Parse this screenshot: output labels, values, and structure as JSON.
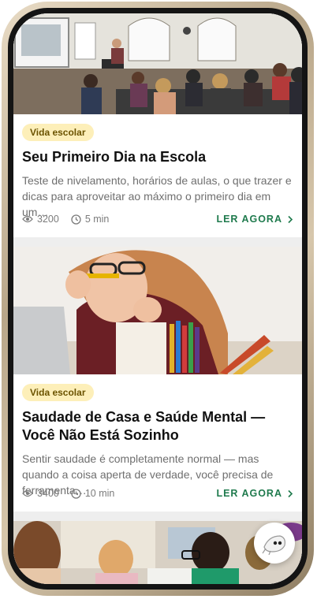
{
  "articles": [
    {
      "category": "Vida escolar",
      "title": "Seu Primeiro Dia na Escola",
      "excerpt": "Teste de nivelamento, horários de aulas, o que trazer e dicas para aproveitar ao máximo o primeiro dia em um…",
      "views": "3200",
      "read_time": "5 min",
      "cta": "LER AGORA"
    },
    {
      "category": "Vida escolar",
      "title": "Saudade de Casa e Saúde Mental — Você Não Está Sozinho",
      "excerpt": "Sentir saudade é completamente normal — mas quando a coisa aperta de verdade, você precisa de ferramenta…",
      "views": "3400",
      "read_time": "10 min",
      "cta": "LER AGORA"
    }
  ],
  "icons": {
    "views": "eye-icon",
    "time": "clock-icon",
    "cta": "chevron-right-icon",
    "fab": "mascot-icon"
  },
  "colors": {
    "badge_bg": "#fdefb9",
    "badge_text": "#6b5300",
    "cta": "#1f7a4d"
  }
}
